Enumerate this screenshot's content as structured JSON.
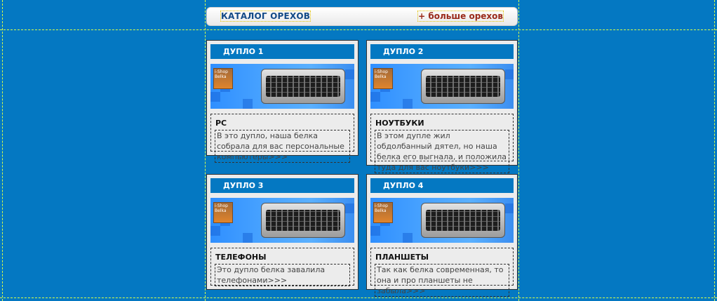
{
  "header": {
    "title": "КАТАЛОГ ОРЕХОВ",
    "more_link": "+ больше орехов"
  },
  "cards": [
    {
      "heading": "ДУПЛО 1",
      "logo_text": "i-Shop Belka",
      "category": "PC",
      "description": "В это дупло, наша белка собрала для вас персональные компьютеры>>>"
    },
    {
      "heading": "ДУПЛО 2",
      "logo_text": "i-Shop Belka",
      "category": "НОУТБУКИ",
      "description": "В этом дупле жил обдолбанный дятел, но наша белка его выгнала, и положила туда для вас ноутбуки>>>"
    },
    {
      "heading": "ДУПЛО 3",
      "logo_text": "i-Shop Belka",
      "category": "ТЕЛЕФОНЫ",
      "description": "Это дупло белка завалила телефонами>>>"
    },
    {
      "heading": "ДУПЛО 4",
      "logo_text": "i-Shop Belka",
      "category": "ПЛАНШЕТЫ",
      "description": "Так как белка современная, то она и про планшеты не забыла>>>"
    }
  ],
  "colors": {
    "background": "#0478c2",
    "card_header": "#0478c2",
    "card_body": "#ececec",
    "catalog_title": "#134a87",
    "more_link": "#9a2a1a"
  }
}
